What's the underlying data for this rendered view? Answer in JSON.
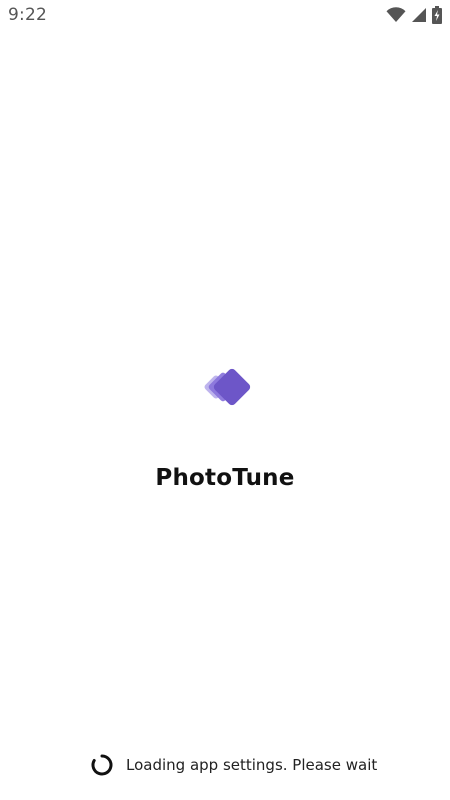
{
  "status_bar": {
    "time": "9:22",
    "icons": [
      "wifi-icon",
      "cellular-signal-icon",
      "battery-charging-icon"
    ]
  },
  "splash": {
    "logo_icon": "stacked-diamonds-logo",
    "app_name": "PhotoTune",
    "brand_colors": [
      "#6d56c8",
      "#8a76dc",
      "#b7aceb"
    ]
  },
  "loading": {
    "spinner_icon": "loading-spinner-icon",
    "message": "Loading app settings. Please wait"
  }
}
